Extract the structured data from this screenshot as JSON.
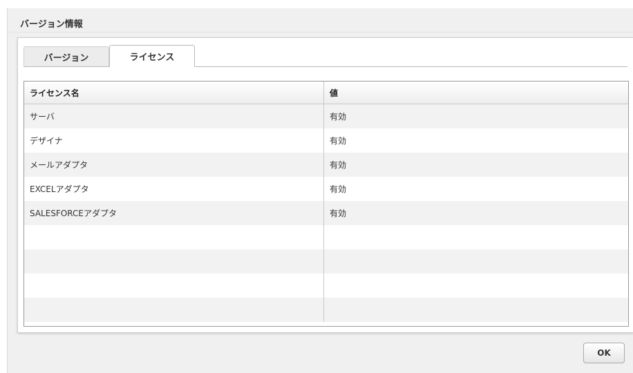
{
  "dialog": {
    "title": "バージョン情報",
    "ok_label": "OK"
  },
  "tabs": [
    {
      "label": "バージョン",
      "active": false
    },
    {
      "label": "ライセンス",
      "active": true
    }
  ],
  "table": {
    "columns": [
      "ライセンス名",
      "値"
    ],
    "rows": [
      {
        "name": "サーバ",
        "value": "有効"
      },
      {
        "name": "デザイナ",
        "value": "有効"
      },
      {
        "name": "メールアダプタ",
        "value": "有効"
      },
      {
        "name": "EXCELアダプタ",
        "value": "有効"
      },
      {
        "name": "SALESFORCEアダプタ",
        "value": "有効"
      },
      {
        "name": "",
        "value": ""
      },
      {
        "name": "",
        "value": ""
      },
      {
        "name": "",
        "value": ""
      },
      {
        "name": "",
        "value": ""
      }
    ]
  },
  "colors": {
    "panel_background": "#f0f0f0",
    "row_alt": "#f2f2f2",
    "grid_border": "#9a9a9a"
  }
}
